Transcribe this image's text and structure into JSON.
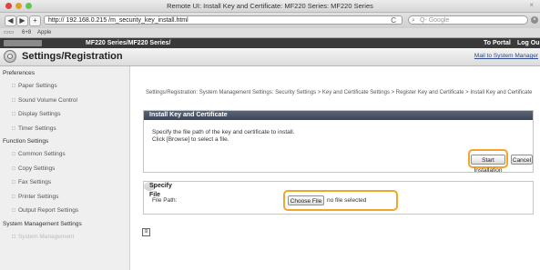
{
  "window": {
    "title": "Remote UI: Install Key and Certificate: MF220 Series: MF220 Series",
    "lights": [
      "#e0443e",
      "#dea123",
      "#62c554"
    ]
  },
  "toolbar": {
    "back": "◀",
    "forward": "▶",
    "add": "+",
    "url": "http:// 192.168.0.215 /m_security_key_install.html",
    "reload": "C",
    "search_placeholder": "Q- Google"
  },
  "bookmarks": {
    "items": [
      "6+8",
      "Apple"
    ]
  },
  "darkbar": {
    "center": "MF220 Series/MF220 Series/",
    "portal": "To Portal",
    "logout": "Log Ou"
  },
  "header": {
    "title": "Settings/Registration",
    "mail_link": "Mail to System Manager"
  },
  "sidebar": {
    "preferences": "Preferences",
    "pref_items": [
      "Paper Settings",
      "Sound Volume Control",
      "Display Settings",
      "Timer Settings"
    ],
    "function": "Function Settings",
    "func_items": [
      "Common Settings",
      "Copy Settings",
      "Fax Settings",
      "Printer Settings",
      "Output Report Settings"
    ],
    "system": "System Management Settings",
    "system_items": [
      "System Management"
    ]
  },
  "main": {
    "breadcrumb": "Settings/Registration: System Management Settings: Security Settings > Key and Certificate Settings > Register Key and Certificate > Install Key and Certificate",
    "install_panel_title": "Install Key and Certificate",
    "instruction_line1": "Specify the file path of the key and certificate to install.",
    "instruction_line2": "Click [Browse] to select a file.",
    "start_button": "Start Installation",
    "cancel_button": "Cancel",
    "specify_title": "Specify File",
    "file_path_label": "File Path:",
    "choose_button": "Choose File",
    "no_file": "no file selected",
    "back_icon": "≡"
  },
  "colors": {
    "highlight": "#f0a52c",
    "panel_header": "#4a5466",
    "darkbar": "#3a3a3a"
  }
}
